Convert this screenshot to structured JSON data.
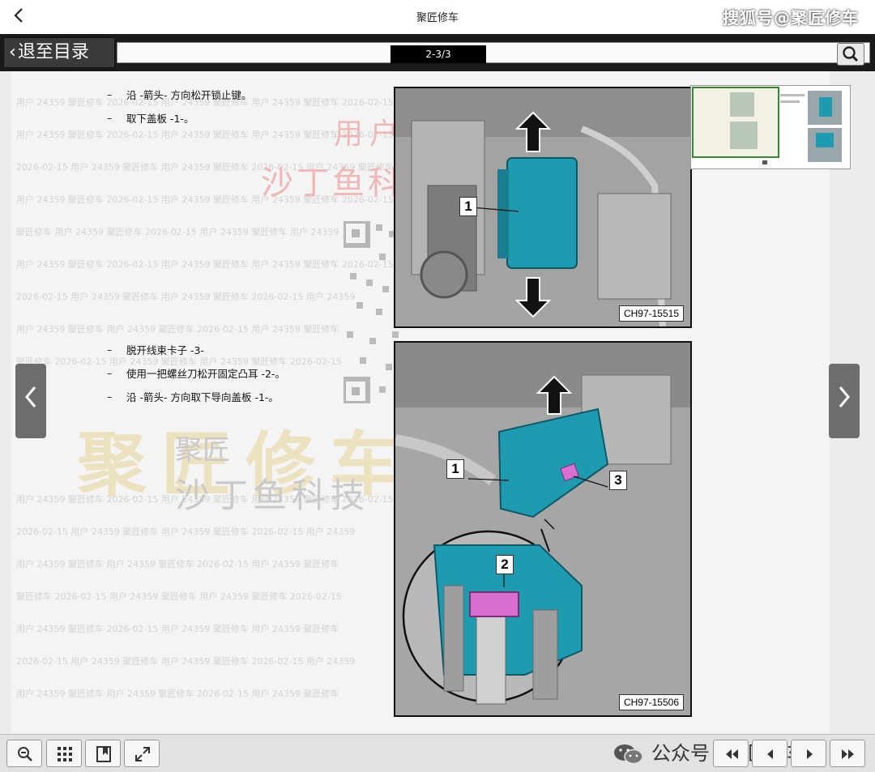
{
  "appbar": {
    "title": "聚匠修车",
    "watermark": "搜狐号@聚匠修车"
  },
  "toolbar": {
    "exit_label": "退至目录",
    "page_indicator": "2-3/3"
  },
  "steps_top": [
    "沿 -箭头- 方向松开锁止键。",
    "取下盖板 -1-。"
  ],
  "steps_bottom": [
    "脱开线束卡子 -3-",
    "使用一把螺丝刀松开固定凸耳 -2-。",
    "沿 -箭头- 方向取下导向盖板 -1-。"
  ],
  "step_marker": "–",
  "figures": [
    {
      "code": "CH97-15515",
      "callouts": [
        "1"
      ]
    },
    {
      "code": "CH97-15506",
      "callouts": [
        "1",
        "3",
        "2"
      ]
    }
  ],
  "watermarks": {
    "red_line1": "用户",
    "red_line2": "沙丁鱼科技",
    "big": "聚匠修车",
    "gray_line1": "聚匠",
    "gray_line2": "沙丁鱼科技"
  },
  "footer_brand": "公众号 · 聚匠修车",
  "colors": {
    "part_teal": "#1e9bb0",
    "part_pink": "#d86fd0",
    "toolbar_dark": "#1a1a1a"
  },
  "icons": {
    "back": "chevron-left-icon",
    "search": "magnifier-icon",
    "zoom": "zoom-out-icon",
    "grid": "grid-icon",
    "bookmark": "bookmark-icon",
    "fullscreen": "expand-icon",
    "first": "first-page-icon",
    "prev": "prev-page-icon",
    "next": "next-page-icon",
    "last": "last-page-icon"
  }
}
